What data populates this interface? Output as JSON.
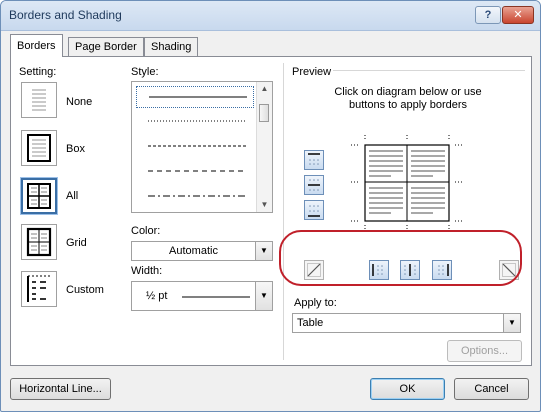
{
  "window": {
    "title": "Borders and Shading",
    "help_label": "?",
    "close_label": "✕"
  },
  "tabs": [
    {
      "label": "Borders"
    },
    {
      "label": "Page Border"
    },
    {
      "label": "Shading"
    }
  ],
  "setting": {
    "label": "Setting:",
    "options": [
      {
        "label": "None"
      },
      {
        "label": "Box"
      },
      {
        "label": "All",
        "selected": true
      },
      {
        "label": "Grid"
      },
      {
        "label": "Custom"
      }
    ]
  },
  "style": {
    "label": "Style:"
  },
  "color": {
    "label": "Color:",
    "value": "Automatic"
  },
  "width": {
    "label": "Width:",
    "value": "½ pt"
  },
  "preview": {
    "label": "Preview",
    "instruction": "Click on diagram below or use buttons to apply borders"
  },
  "apply_to": {
    "label": "Apply to:",
    "value": "Table"
  },
  "buttons": {
    "options": "Options...",
    "horizontal_line": "Horizontal Line...",
    "ok": "OK",
    "cancel": "Cancel"
  },
  "colors": {
    "accent": "#3a6ea5",
    "highlight_oval": "#c0202a"
  }
}
